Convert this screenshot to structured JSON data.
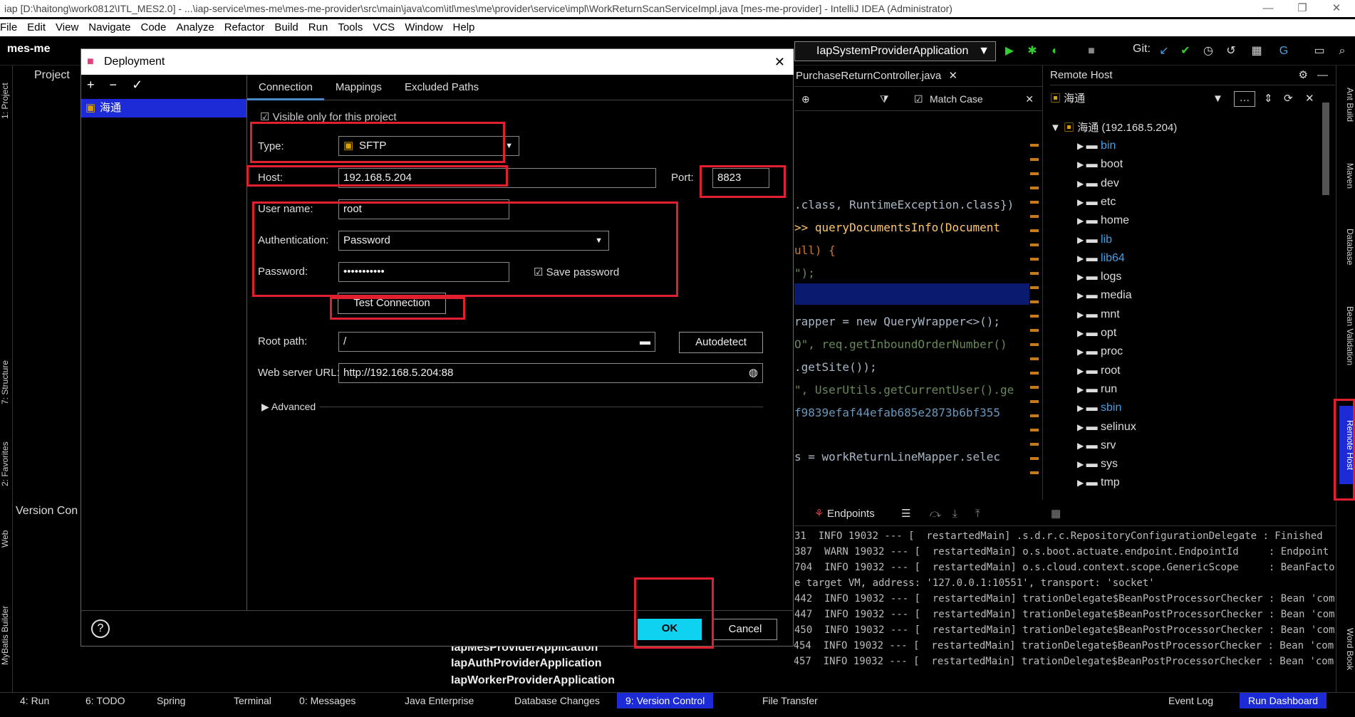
{
  "window": {
    "title": "iap [D:\\haitong\\work0812\\ITL_MES2.0] - ...\\iap-service\\mes-me\\mes-me-provider\\src\\main\\java\\com\\itl\\mes\\me\\provider\\service\\impl\\WorkReturnScanServiceImpl.java [mes-me-provider] - IntelliJ IDEA (Administrator)"
  },
  "menu": [
    "File",
    "Edit",
    "View",
    "Navigate",
    "Code",
    "Analyze",
    "Refactor",
    "Build",
    "Run",
    "Tools",
    "VCS",
    "Window",
    "Help"
  ],
  "toolbar": {
    "breadcrumb": "mes-me",
    "run_config": "IapSystemProviderApplication",
    "git_label": "Git:"
  },
  "left_panel": {
    "project_label": "Project",
    "version_control_label": "Version Con",
    "side_labels": [
      "1: Project",
      "7: Structure",
      "2: Favorites",
      "Web",
      "MyBatis Builder"
    ]
  },
  "dialog": {
    "title": "Deployment",
    "list_buttons": [
      "+",
      "−",
      "✓"
    ],
    "server_name": "海通",
    "tabs": [
      "Connection",
      "Mappings",
      "Excluded Paths"
    ],
    "visible_only_label": "Visible only for this project",
    "type_label": "Type:",
    "type_value": "SFTP",
    "host_label": "Host:",
    "host_value": "192.168.5.204",
    "port_label": "Port:",
    "port_value": "8823",
    "username_label": "User name:",
    "username_value": "root",
    "auth_label": "Authentication:",
    "auth_value": "Password",
    "password_label": "Password:",
    "password_value": "•••••••••••",
    "save_password_label": "Save password",
    "test_connection_label": "Test Connection",
    "root_path_label": "Root path:",
    "root_path_value": "/",
    "autodetect_label": "Autodetect",
    "web_url_label": "Web server URL:",
    "web_url_value": "http://192.168.5.204:88",
    "advanced_label": "Advanced",
    "ok_label": "OK",
    "cancel_label": "Cancel",
    "help_label": "?"
  },
  "editor": {
    "tab_label": "PurchaseReturnController.java",
    "match_case_label": "Match Case",
    "lines": [
      ".class, RuntimeException.class})",
      ">> queryDocumentsInfo(Document",
      "ull) {",
      "\");",
      "",
      "rapper = new QueryWrapper<>();",
      "O\", req.getInboundOrderNumber()",
      ".getSite());",
      "\", UserUtils.getCurrentUser().ge",
      "f9839efaf44efab685e2873b6bf355",
      "",
      "s = workReturnLineMapper.selec"
    ]
  },
  "remote_host": {
    "title": "Remote Host",
    "server": "海通",
    "root_node": "海通 (192.168.5.204)",
    "folders": [
      "bin",
      "boot",
      "dev",
      "etc",
      "home",
      "lib",
      "lib64",
      "logs",
      "media",
      "mnt",
      "opt",
      "proc",
      "root",
      "run",
      "sbin",
      "selinux",
      "srv",
      "sys",
      "tmp"
    ]
  },
  "console": {
    "endpoints_label": "Endpoints",
    "lines": [
      "31  INFO 19032 --- [  restartedMain] .s.d.r.c.RepositoryConfigurationDelegate : Finished",
      "387  WARN 19032 --- [  restartedMain] o.s.boot.actuate.endpoint.EndpointId     : Endpoint",
      "704  INFO 19032 --- [  restartedMain] o.s.cloud.context.scope.GenericScope     : BeanFacto",
      "e target VM, address: '127.0.0.1:10551', transport: 'socket'",
      "442  INFO 19032 --- [  restartedMain] trationDelegate$BeanPostProcessorChecker : Bean 'com",
      "447  INFO 19032 --- [  restartedMain] trationDelegate$BeanPostProcessorChecker : Bean 'com",
      "450  INFO 19032 --- [  restartedMain] trationDelegate$BeanPostProcessorChecker : Bean 'com",
      "2021-08-26 11:15:46.454  INFO 19032 --- [  restartedMain] trationDelegate$BeanPostProcessorChecker : Bean 'com",
      "2021-08-26 11:15:46.457  INFO 19032 --- [  restartedMain] trationDelegate$BeanPostProcessorChecker : Bean 'com"
    ]
  },
  "services": [
    "IapMesProviderApplication",
    "IapAuthProviderApplication",
    "IapWorkerProviderApplication"
  ],
  "statusbar": {
    "items": [
      "4: Run",
      "6: TODO",
      "Spring",
      "Terminal",
      "0: Messages",
      "Java Enterprise",
      "Database Changes",
      "9: Version Control",
      "File Transfer"
    ],
    "right_items": [
      "Event Log",
      "Run Dashboard"
    ]
  },
  "right_strip": [
    "Ant Build",
    "Maven",
    "Database",
    "Bean Validation",
    "Remote Host",
    "Word Book"
  ]
}
